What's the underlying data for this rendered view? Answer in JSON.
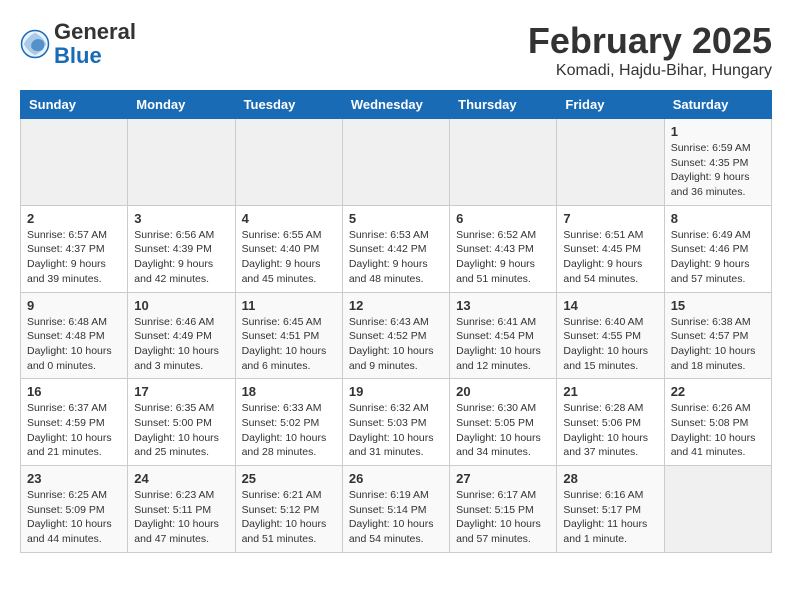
{
  "header": {
    "logo_general": "General",
    "logo_blue": "Blue",
    "month_title": "February 2025",
    "location": "Komadi, Hajdu-Bihar, Hungary"
  },
  "weekdays": [
    "Sunday",
    "Monday",
    "Tuesday",
    "Wednesday",
    "Thursday",
    "Friday",
    "Saturday"
  ],
  "weeks": [
    [
      {
        "day": "",
        "info": ""
      },
      {
        "day": "",
        "info": ""
      },
      {
        "day": "",
        "info": ""
      },
      {
        "day": "",
        "info": ""
      },
      {
        "day": "",
        "info": ""
      },
      {
        "day": "",
        "info": ""
      },
      {
        "day": "1",
        "info": "Sunrise: 6:59 AM\nSunset: 4:35 PM\nDaylight: 9 hours and 36 minutes."
      }
    ],
    [
      {
        "day": "2",
        "info": "Sunrise: 6:57 AM\nSunset: 4:37 PM\nDaylight: 9 hours and 39 minutes."
      },
      {
        "day": "3",
        "info": "Sunrise: 6:56 AM\nSunset: 4:39 PM\nDaylight: 9 hours and 42 minutes."
      },
      {
        "day": "4",
        "info": "Sunrise: 6:55 AM\nSunset: 4:40 PM\nDaylight: 9 hours and 45 minutes."
      },
      {
        "day": "5",
        "info": "Sunrise: 6:53 AM\nSunset: 4:42 PM\nDaylight: 9 hours and 48 minutes."
      },
      {
        "day": "6",
        "info": "Sunrise: 6:52 AM\nSunset: 4:43 PM\nDaylight: 9 hours and 51 minutes."
      },
      {
        "day": "7",
        "info": "Sunrise: 6:51 AM\nSunset: 4:45 PM\nDaylight: 9 hours and 54 minutes."
      },
      {
        "day": "8",
        "info": "Sunrise: 6:49 AM\nSunset: 4:46 PM\nDaylight: 9 hours and 57 minutes."
      }
    ],
    [
      {
        "day": "9",
        "info": "Sunrise: 6:48 AM\nSunset: 4:48 PM\nDaylight: 10 hours and 0 minutes."
      },
      {
        "day": "10",
        "info": "Sunrise: 6:46 AM\nSunset: 4:49 PM\nDaylight: 10 hours and 3 minutes."
      },
      {
        "day": "11",
        "info": "Sunrise: 6:45 AM\nSunset: 4:51 PM\nDaylight: 10 hours and 6 minutes."
      },
      {
        "day": "12",
        "info": "Sunrise: 6:43 AM\nSunset: 4:52 PM\nDaylight: 10 hours and 9 minutes."
      },
      {
        "day": "13",
        "info": "Sunrise: 6:41 AM\nSunset: 4:54 PM\nDaylight: 10 hours and 12 minutes."
      },
      {
        "day": "14",
        "info": "Sunrise: 6:40 AM\nSunset: 4:55 PM\nDaylight: 10 hours and 15 minutes."
      },
      {
        "day": "15",
        "info": "Sunrise: 6:38 AM\nSunset: 4:57 PM\nDaylight: 10 hours and 18 minutes."
      }
    ],
    [
      {
        "day": "16",
        "info": "Sunrise: 6:37 AM\nSunset: 4:59 PM\nDaylight: 10 hours and 21 minutes."
      },
      {
        "day": "17",
        "info": "Sunrise: 6:35 AM\nSunset: 5:00 PM\nDaylight: 10 hours and 25 minutes."
      },
      {
        "day": "18",
        "info": "Sunrise: 6:33 AM\nSunset: 5:02 PM\nDaylight: 10 hours and 28 minutes."
      },
      {
        "day": "19",
        "info": "Sunrise: 6:32 AM\nSunset: 5:03 PM\nDaylight: 10 hours and 31 minutes."
      },
      {
        "day": "20",
        "info": "Sunrise: 6:30 AM\nSunset: 5:05 PM\nDaylight: 10 hours and 34 minutes."
      },
      {
        "day": "21",
        "info": "Sunrise: 6:28 AM\nSunset: 5:06 PM\nDaylight: 10 hours and 37 minutes."
      },
      {
        "day": "22",
        "info": "Sunrise: 6:26 AM\nSunset: 5:08 PM\nDaylight: 10 hours and 41 minutes."
      }
    ],
    [
      {
        "day": "23",
        "info": "Sunrise: 6:25 AM\nSunset: 5:09 PM\nDaylight: 10 hours and 44 minutes."
      },
      {
        "day": "24",
        "info": "Sunrise: 6:23 AM\nSunset: 5:11 PM\nDaylight: 10 hours and 47 minutes."
      },
      {
        "day": "25",
        "info": "Sunrise: 6:21 AM\nSunset: 5:12 PM\nDaylight: 10 hours and 51 minutes."
      },
      {
        "day": "26",
        "info": "Sunrise: 6:19 AM\nSunset: 5:14 PM\nDaylight: 10 hours and 54 minutes."
      },
      {
        "day": "27",
        "info": "Sunrise: 6:17 AM\nSunset: 5:15 PM\nDaylight: 10 hours and 57 minutes."
      },
      {
        "day": "28",
        "info": "Sunrise: 6:16 AM\nSunset: 5:17 PM\nDaylight: 11 hours and 1 minute."
      },
      {
        "day": "",
        "info": ""
      }
    ]
  ]
}
